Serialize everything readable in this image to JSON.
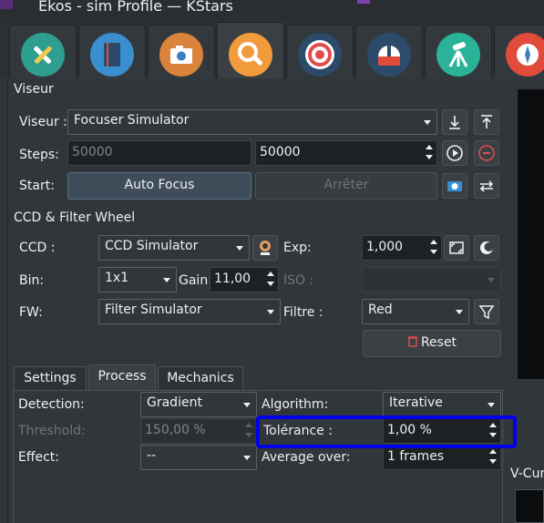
{
  "window": {
    "title": "Ekos - sim Profile — KStars"
  },
  "tabs": [
    {
      "name": "setup",
      "color": "#2e9e8f",
      "active": false
    },
    {
      "name": "scheduler",
      "color": "#3a8fd0",
      "active": false
    },
    {
      "name": "capture",
      "color": "#d9843a",
      "active": false
    },
    {
      "name": "focus",
      "color": "#f29b3c",
      "active": true
    },
    {
      "name": "guide",
      "color": "#e24b4b",
      "active": false
    },
    {
      "name": "observatory",
      "color": "#2c4a6a",
      "active": false
    },
    {
      "name": "align",
      "color": "#2bb39a",
      "active": false
    },
    {
      "name": "analyze",
      "color": "#e04b3c",
      "active": false
    }
  ],
  "viseur": {
    "group_title": "Viseur",
    "viseur_label": "Viseur :",
    "viseur_value": "Focuser Simulator",
    "steps_label": "Steps:",
    "steps_current": "50000",
    "steps_target": "50000",
    "start_label": "Start:",
    "autofocus_button": "Auto Focus",
    "stop_button": "Arrêter"
  },
  "ccd": {
    "group_title": "CCD & Filter Wheel",
    "ccd_label": "CCD :",
    "ccd_value": "CCD Simulator",
    "exp_label": "Exp:",
    "exp_value": "1,000",
    "bin_label": "Bin:",
    "bin_value": "1x1",
    "gain_label": "Gain:",
    "gain_value": "11,00",
    "iso_label": "ISO :",
    "fw_label": "FW:",
    "fw_value": "Filter Simulator",
    "filtre_label": "Filtre :",
    "filtre_value": "Red",
    "reset_button": "Reset"
  },
  "settings_tabs": [
    {
      "label": "Settings",
      "active": false
    },
    {
      "label": "Process",
      "active": true
    },
    {
      "label": "Mechanics",
      "active": false
    }
  ],
  "process": {
    "detection_label": "Detection:",
    "detection_value": "Gradient",
    "algorithm_label": "Algorithm:",
    "algorithm_value": "Iterative",
    "threshold_label": "Threshold:",
    "threshold_value": "150,00 %",
    "tolerance_label": "Tolérance :",
    "tolerance_value": "1,00 %",
    "effect_label": "Effect:",
    "effect_value": "--",
    "average_label": "Average over:",
    "average_value": "1 frames"
  },
  "vcurve_label": "V-Cur",
  "colors": {
    "highlight": "#0000ee",
    "reset_icon": "#e04b4b",
    "stop_icon": "#e04b4b"
  }
}
